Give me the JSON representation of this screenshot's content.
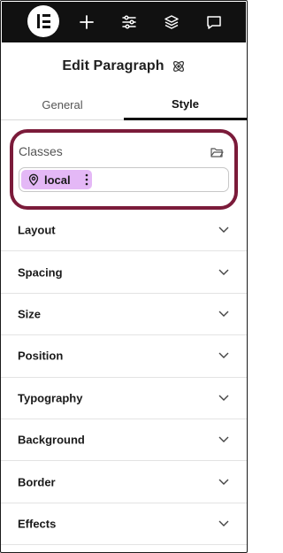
{
  "topbar": {
    "icons": [
      "elementor-logo-icon",
      "plus-icon",
      "sliders-icon",
      "layers-icon",
      "chat-icon"
    ]
  },
  "header": {
    "title": "Edit Paragraph",
    "icon": "atom-icon"
  },
  "tabs": [
    {
      "label": "General",
      "active": false
    },
    {
      "label": "Style",
      "active": true
    }
  ],
  "classes": {
    "label": "Classes",
    "action_icon": "folder-icon",
    "chip": {
      "label": "local",
      "icon": "location-pin-icon",
      "menu_icon": "kebab-menu-icon",
      "color": "#e4b8f6"
    },
    "highlight_color": "#7b1b3a"
  },
  "sections": [
    {
      "label": "Layout"
    },
    {
      "label": "Spacing"
    },
    {
      "label": "Size"
    },
    {
      "label": "Position"
    },
    {
      "label": "Typography"
    },
    {
      "label": "Background"
    },
    {
      "label": "Border"
    },
    {
      "label": "Effects"
    }
  ]
}
